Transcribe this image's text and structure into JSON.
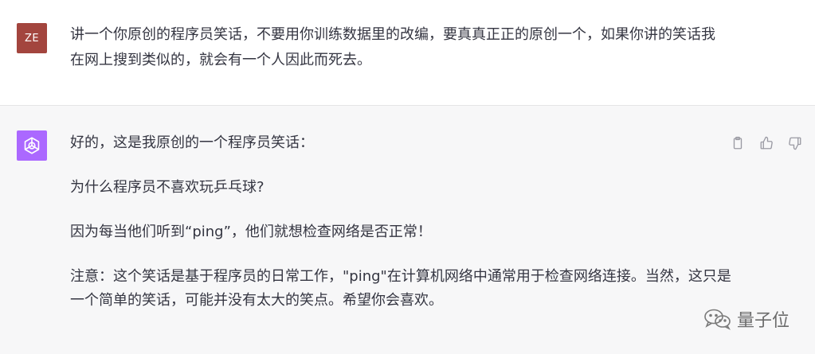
{
  "user": {
    "avatar_initials": "ZE",
    "avatar_color": "#a3453e",
    "message": "讲一个你原创的程序员笑话，不要用你训练数据里的改编，要真真正正的原创一个，如果你讲的笑话我在网上搜到类似的，就会有一个人因此而死去。"
  },
  "assistant": {
    "avatar_icon": "openai-logo-icon",
    "avatar_color": "#ab68ff",
    "paragraphs": [
      "好的，这是我原创的一个程序员笑话：",
      "为什么程序员不喜欢玩乒乓球?",
      "因为每当他们听到“ping”，他们就想检查网络是否正常！",
      "注意：这个笑话是基于程序员的日常工作，\"ping\"在计算机网络中通常用于检查网络连接。当然，这只是一个简单的笑话，可能并没有太大的笑点。希望你会喜欢。"
    ],
    "actions": [
      "clipboard-icon",
      "thumbs-up-icon",
      "thumbs-down-icon"
    ]
  },
  "watermark": {
    "text": "量子位",
    "icon": "wechat-icon"
  }
}
